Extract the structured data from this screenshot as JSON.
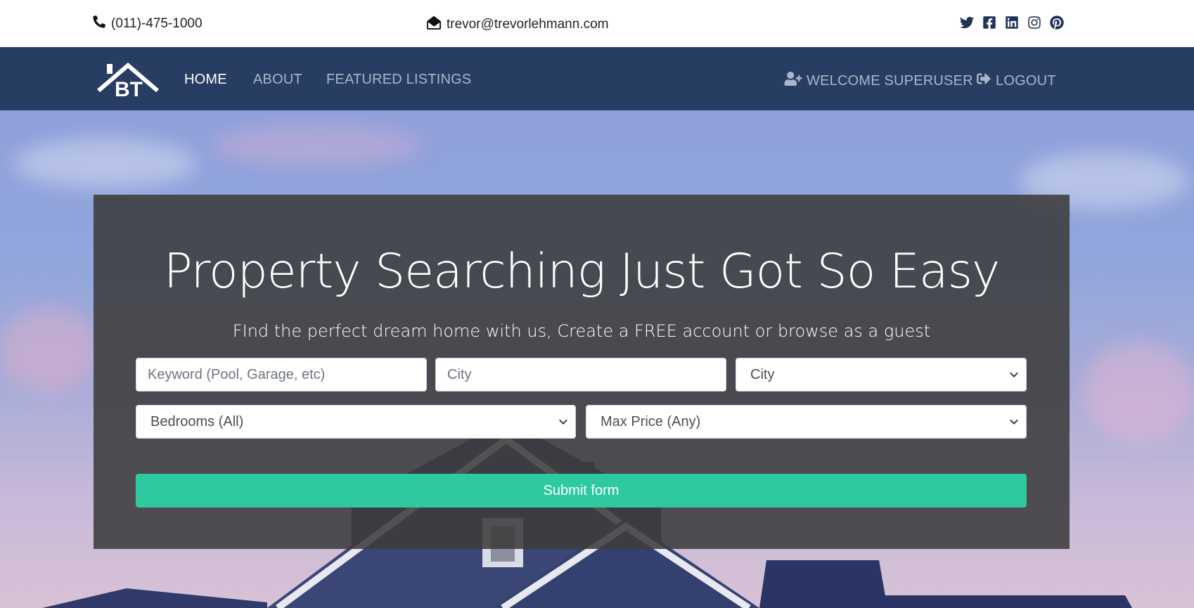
{
  "topbar": {
    "phone": "(011)-475-1000",
    "email": "trevor@trevorlehmann.com",
    "socials": [
      "twitter-icon",
      "facebook-icon",
      "linkedin-icon",
      "instagram-icon",
      "pinterest-icon"
    ]
  },
  "nav": {
    "logo_text": "BT",
    "home": "HOME",
    "about": "ABOUT",
    "featured": "FEATURED LISTINGS",
    "welcome": "WELCOME SUPERUSER",
    "logout": "LOGOUT"
  },
  "hero": {
    "title": "Property Searching Just Got So Easy",
    "subtitle": "FInd the perfect dream home with us, Create a FREE account or browse as a guest"
  },
  "search": {
    "keyword_placeholder": "Keyword (Pool, Garage, etc)",
    "city_placeholder": "City",
    "city_select": "City",
    "bedrooms_select": "Bedrooms (All)",
    "price_select": "Max Price (Any)",
    "submit_label": "Submit form"
  },
  "colors": {
    "navbar": "#283d62",
    "accent": "#2ec99f",
    "nav_text": "#a9b6cc"
  }
}
